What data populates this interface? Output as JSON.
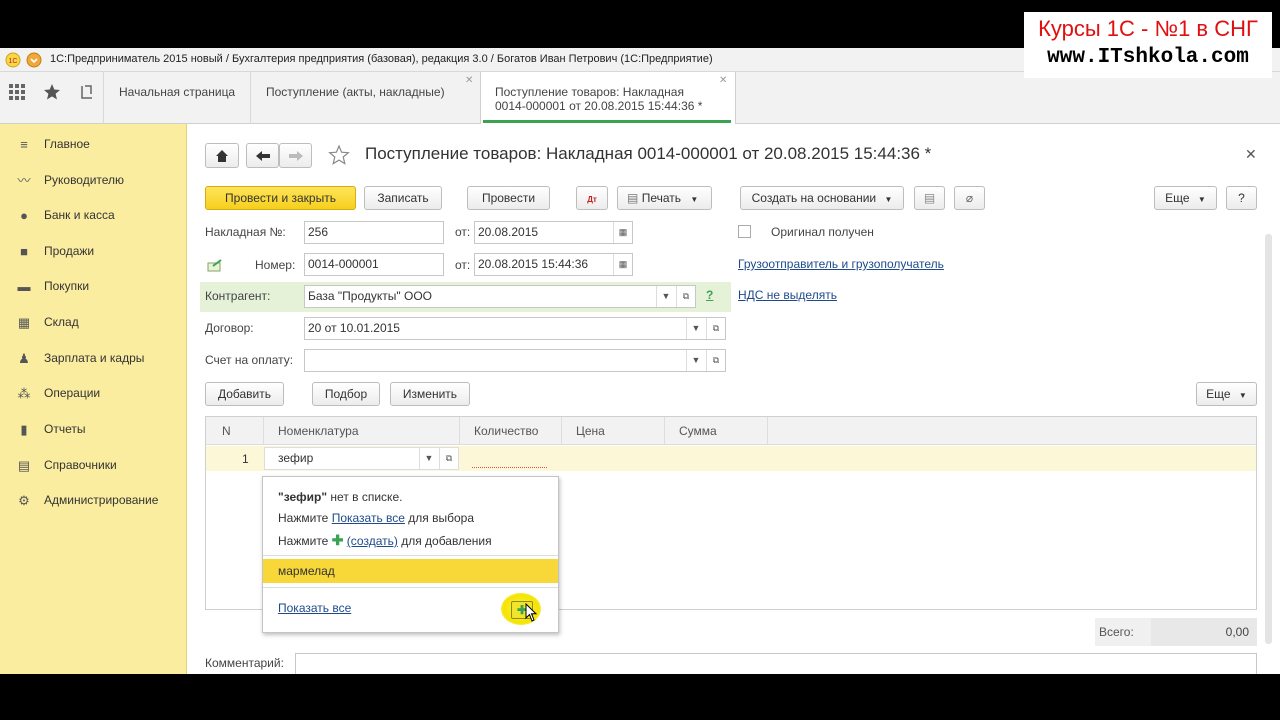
{
  "brand": {
    "line1": "Курсы 1С - №1 в СНГ",
    "line2": "www.ITshkola.com"
  },
  "window": {
    "title": "1С:Предприниматель 2015 новый / Бухгалтерия предприятия (базовая), редакция 3.0 / Богатов Иван Петрович  (1С:Предприятие)"
  },
  "tabs": [
    {
      "label": "Начальная страница"
    },
    {
      "label": "Поступление (акты, накладные)"
    },
    {
      "label_line1": "Поступление товаров: Накладная",
      "label_line2": "0014-000001 от 20.08.2015 15:44:36 *"
    }
  ],
  "sidebar": {
    "items": [
      {
        "label": "Главное",
        "icon": "menu-icon"
      },
      {
        "label": "Руководителю",
        "icon": "trend-icon"
      },
      {
        "label": "Банк и касса",
        "icon": "coin-icon"
      },
      {
        "label": "Продажи",
        "icon": "bag-icon"
      },
      {
        "label": "Покупки",
        "icon": "cart-icon"
      },
      {
        "label": "Склад",
        "icon": "warehouse-icon"
      },
      {
        "label": "Зарплата и кадры",
        "icon": "person-icon"
      },
      {
        "label": "Операции",
        "icon": "operations-icon"
      },
      {
        "label": "Отчеты",
        "icon": "bar-chart-icon"
      },
      {
        "label": "Справочники",
        "icon": "book-icon"
      },
      {
        "label": "Администрирование",
        "icon": "gear-icon"
      }
    ]
  },
  "doc": {
    "title": "Поступление товаров: Накладная 0014-000001 от 20.08.2015 15:44:36 *",
    "toolbar": {
      "post_close": "Провести и закрыть",
      "save": "Записать",
      "post": "Провести",
      "print": "Печать",
      "create_based": "Создать на основании",
      "more": "Еще",
      "help": "?"
    },
    "fields": {
      "invoice_label": "Накладная №:",
      "invoice_value": "256",
      "from_label": "от:",
      "invoice_date": "20.08.2015",
      "number_label": "Номер:",
      "number_value": "0014-000001",
      "number_date": "20.08.2015 15:44:36",
      "counterparty_label": "Контрагент:",
      "counterparty_value": "База \"Продукты\" ООО",
      "contract_label": "Договор:",
      "contract_value": "20 от 10.01.2015",
      "payment_label": "Счет на оплату:",
      "payment_value": "",
      "original_label": "Оригинал получен",
      "shipper_link": "Грузоотправитель и грузополучатель",
      "vat_link": "НДС не выделять",
      "help_mark": "?"
    },
    "table_toolbar": {
      "add": "Добавить",
      "pick": "Подбор",
      "change": "Изменить",
      "more": "Еще"
    },
    "table": {
      "columns": [
        "N",
        "Номенклатура",
        "Количество",
        "Цена",
        "Сумма"
      ],
      "rows": [
        {
          "n": "1",
          "item": "зефир",
          "qty": "",
          "price": "",
          "sum": ""
        }
      ]
    },
    "dropdown": {
      "line1_bold": "\"зефир\"",
      "line1_rest": " нет в списке.",
      "line2_pre": "Нажмите ",
      "line2_link": "Показать все",
      "line2_post": " для выбора",
      "line3_pre": "Нажмите ",
      "line3_link": "(создать)",
      "line3_post": " для добавления",
      "option": "мармелад",
      "show_all": "Показать все"
    },
    "totals": {
      "label": "Всего:",
      "value": "0,00"
    },
    "comment_label": "Комментарий:"
  }
}
